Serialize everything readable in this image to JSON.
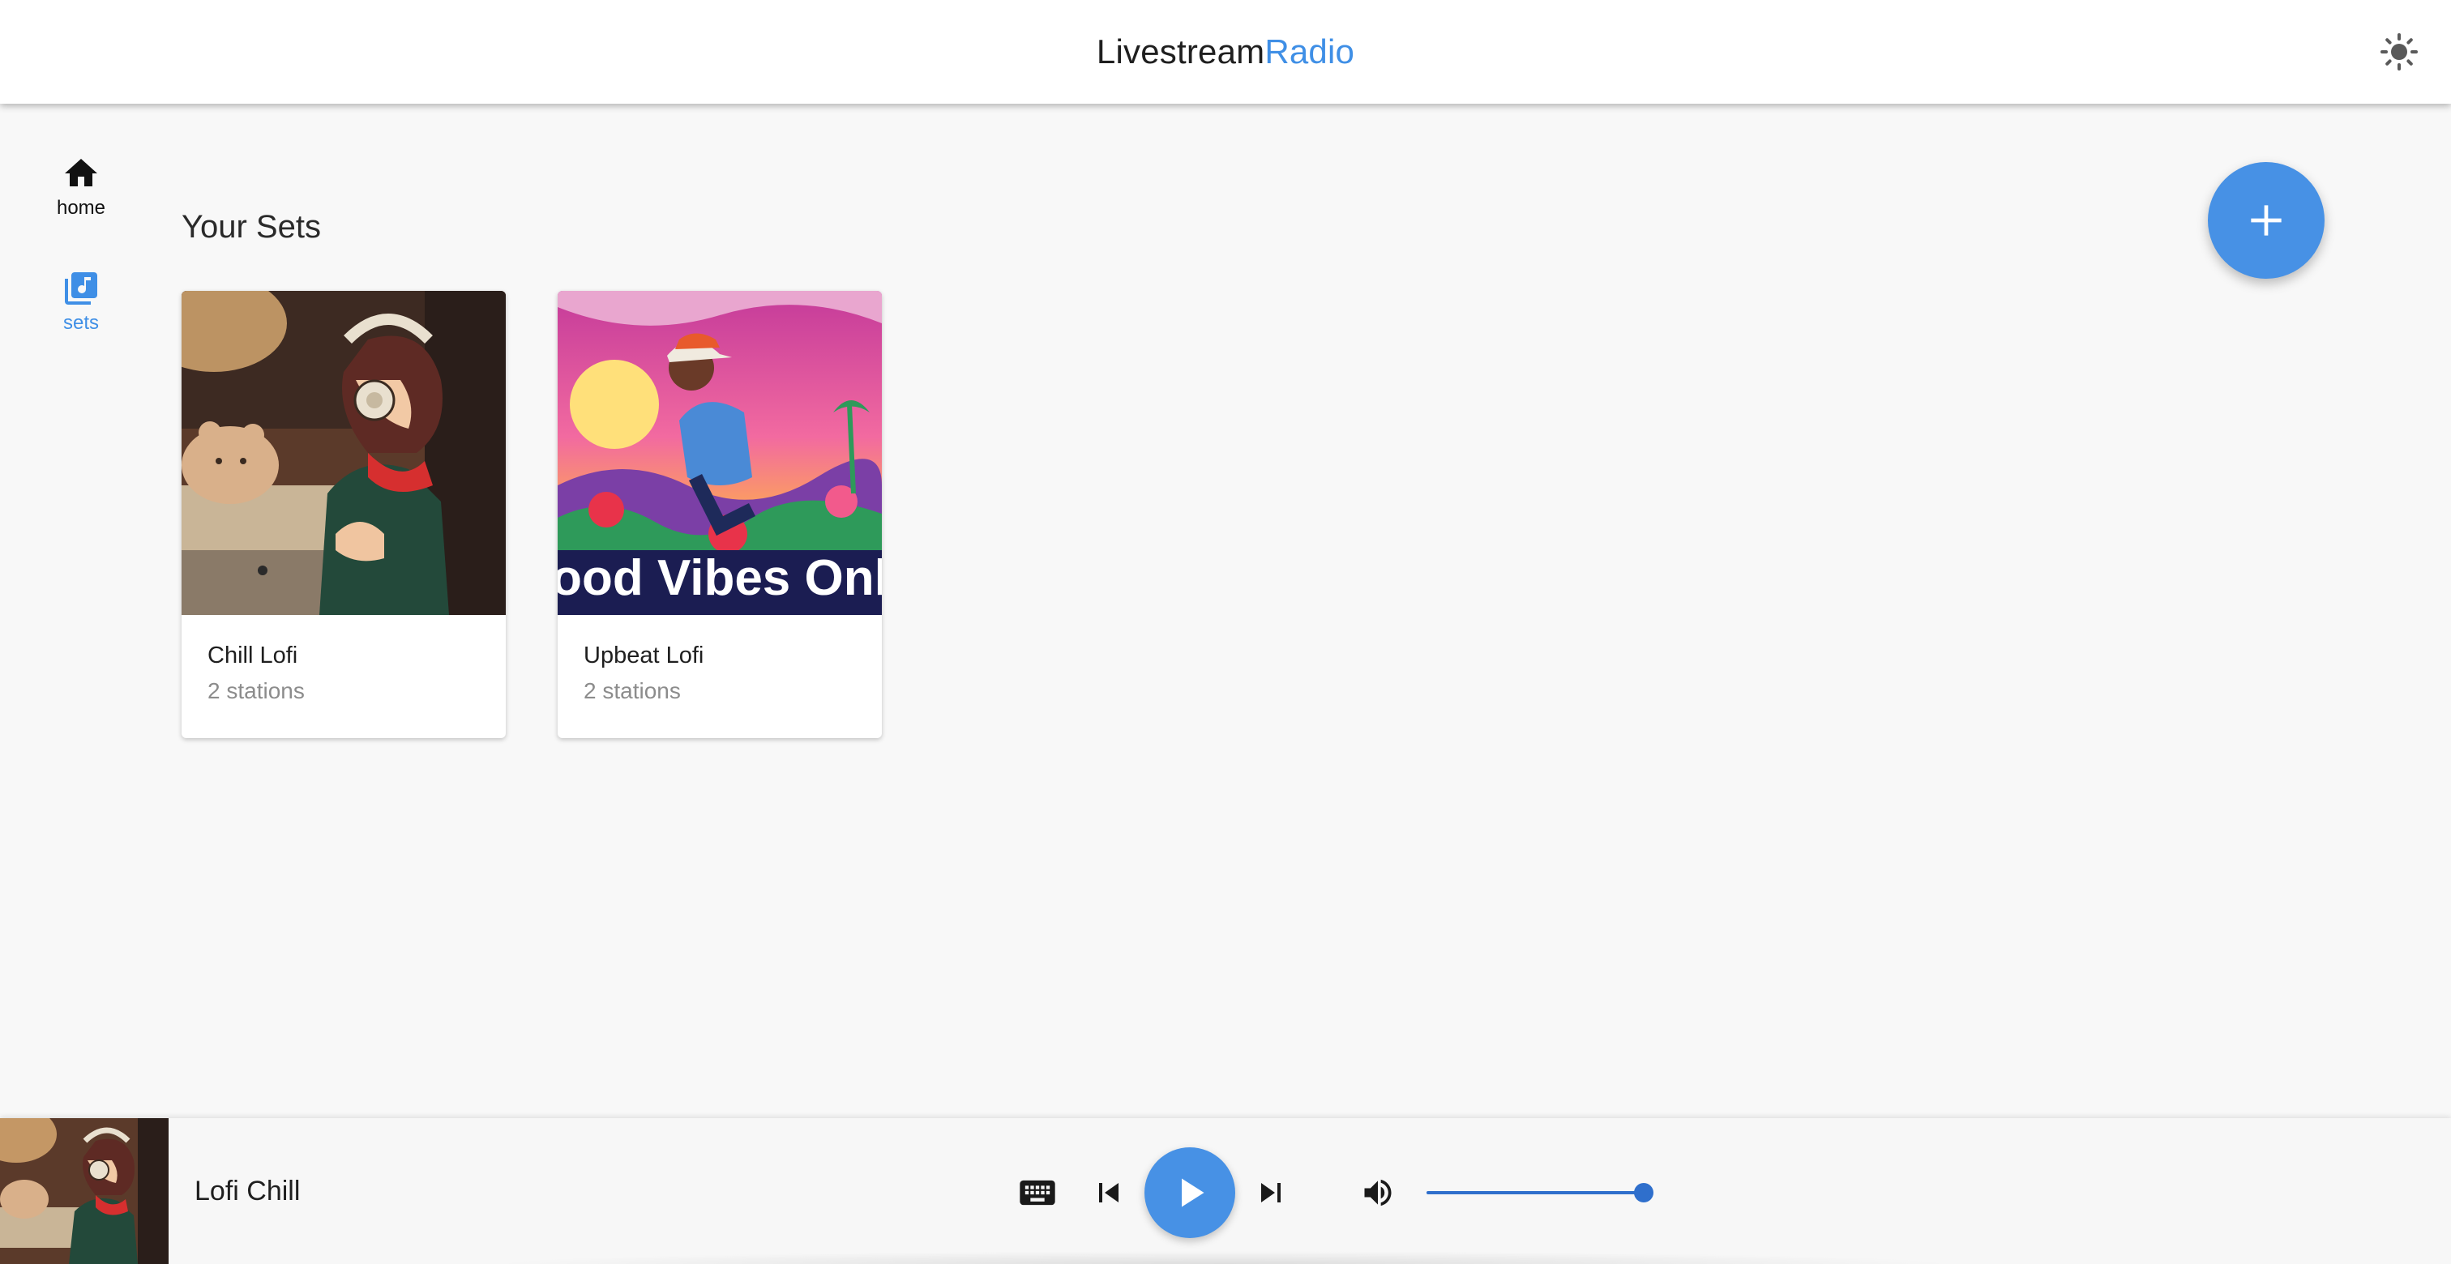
{
  "app": {
    "title_part1": "Livestream",
    "title_part2": "Radio",
    "accent_color": "#3f8fe6",
    "theme_toggle_icon": "sun-icon"
  },
  "nav": {
    "items": [
      {
        "label": "home",
        "icon": "home-icon",
        "active": false
      },
      {
        "label": "sets",
        "icon": "library-music-icon",
        "active": true
      }
    ]
  },
  "main": {
    "heading": "Your Sets",
    "add_button_icon": "plus-icon",
    "sets": [
      {
        "title": "Chill Lofi",
        "subtitle": "2 stations",
        "artwork": "lofi-girl-studying-artwork"
      },
      {
        "title": "Upbeat Lofi",
        "subtitle": "2 stations",
        "artwork_text": "ood Vibes Onl",
        "artwork": "good-vibes-cyclist-artwork"
      }
    ]
  },
  "player": {
    "now_playing": "Lofi Chill",
    "icons": [
      "keyboard-icon",
      "skip-previous-icon",
      "play-icon",
      "skip-next-icon",
      "volume-icon"
    ],
    "volume": 1.0
  }
}
